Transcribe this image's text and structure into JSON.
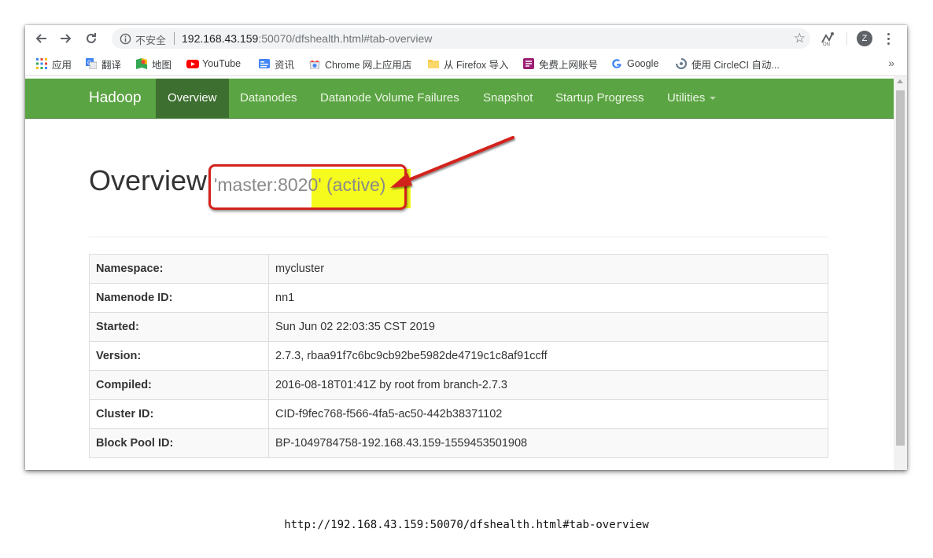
{
  "browser": {
    "security_label": "不安全",
    "url_host": "192.168.43.159",
    "url_rest": ":50070/dfshealth.html#tab-overview",
    "avatar_initial": "Z",
    "bookmarks_more": "»",
    "bookmarks": [
      {
        "label": "应用",
        "icon": "apps-grid-icon"
      },
      {
        "label": "翻译",
        "icon": "google-translate-icon"
      },
      {
        "label": "地图",
        "icon": "google-maps-icon"
      },
      {
        "label": "YouTube",
        "icon": "youtube-icon"
      },
      {
        "label": "资讯",
        "icon": "google-news-icon"
      },
      {
        "label": "Chrome 网上应用店",
        "icon": "chrome-web-store-icon"
      },
      {
        "label": "从 Firefox 导入",
        "icon": "folder-icon"
      },
      {
        "label": "免费上网账号",
        "icon": "bookmark-site-icon"
      },
      {
        "label": "Google",
        "icon": "google-g-icon"
      },
      {
        "label": "使用 CircleCI 自动...",
        "icon": "circleci-icon"
      }
    ]
  },
  "navbar": {
    "brand": "Hadoop",
    "links": [
      {
        "label": "Overview",
        "active": true
      },
      {
        "label": "Datanodes"
      },
      {
        "label": "Datanode Volume Failures"
      },
      {
        "label": "Snapshot"
      },
      {
        "label": "Startup Progress"
      },
      {
        "label": "Utilities",
        "dropdown": true
      }
    ]
  },
  "page": {
    "title": "Overview",
    "subtitle": "'master:8020' (active)"
  },
  "overview_table": [
    {
      "label": "Namespace:",
      "value": "mycluster"
    },
    {
      "label": "Namenode ID:",
      "value": "nn1"
    },
    {
      "label": "Started:",
      "value": "Sun Jun 02 22:03:35 CST 2019"
    },
    {
      "label": "Version:",
      "value": "2.7.3, rbaa91f7c6bc9cb92be5982de4719c1c8af91ccff"
    },
    {
      "label": "Compiled:",
      "value": "2016-08-18T01:41Z by root from branch-2.7.3"
    },
    {
      "label": "Cluster ID:",
      "value": "CID-f9fec768-f566-4fa5-ac50-442b38371102"
    },
    {
      "label": "Block Pool ID:",
      "value": "BP-1049784758-192.168.43.159-1559453501908"
    }
  ],
  "annotation": {
    "highlight_color": "#f4fb1d",
    "box_color": "#d3221d"
  },
  "caption": "http://192.168.43.159:50070/dfshealth.html#tab-overview"
}
